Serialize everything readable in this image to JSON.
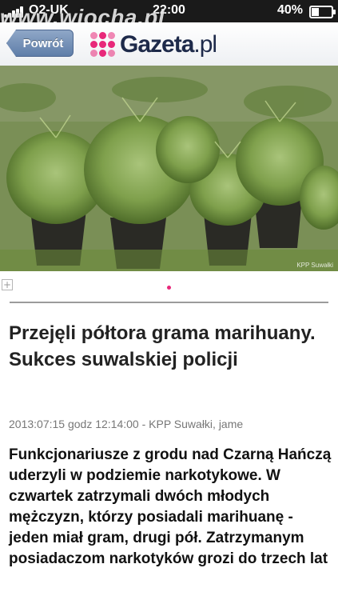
{
  "status_bar": {
    "carrier": "O2-UK",
    "time": "22:00",
    "battery": "40%",
    "battery_level": 0.4
  },
  "watermark": "www.wiocha.pl",
  "nav": {
    "back_label": "Powrót",
    "logo_text": "Gazeta",
    "logo_suffix": ".pl",
    "accent_color": "#e8287a"
  },
  "photo": {
    "credit": "KPP Suwałki"
  },
  "article": {
    "headline": "Przejęli półtora grama marihuany. Sukces suwalskiej policji",
    "meta": "2013:07:15 godz 12:14:00 - KPP Suwałki, jame",
    "lead": "Funkcjonariusze z grodu nad Czarną Hańczą uderzyli w podziemie narkotykowe. W czwartek zatrzymali dwóch młodych mężczyzn, którzy posiadali marihuanę - jeden miał gram, drugi pół. Zatrzymanym posiadaczom narkotyków grozi do trzech lat"
  },
  "pager": {
    "pages": 1,
    "current": 1
  }
}
